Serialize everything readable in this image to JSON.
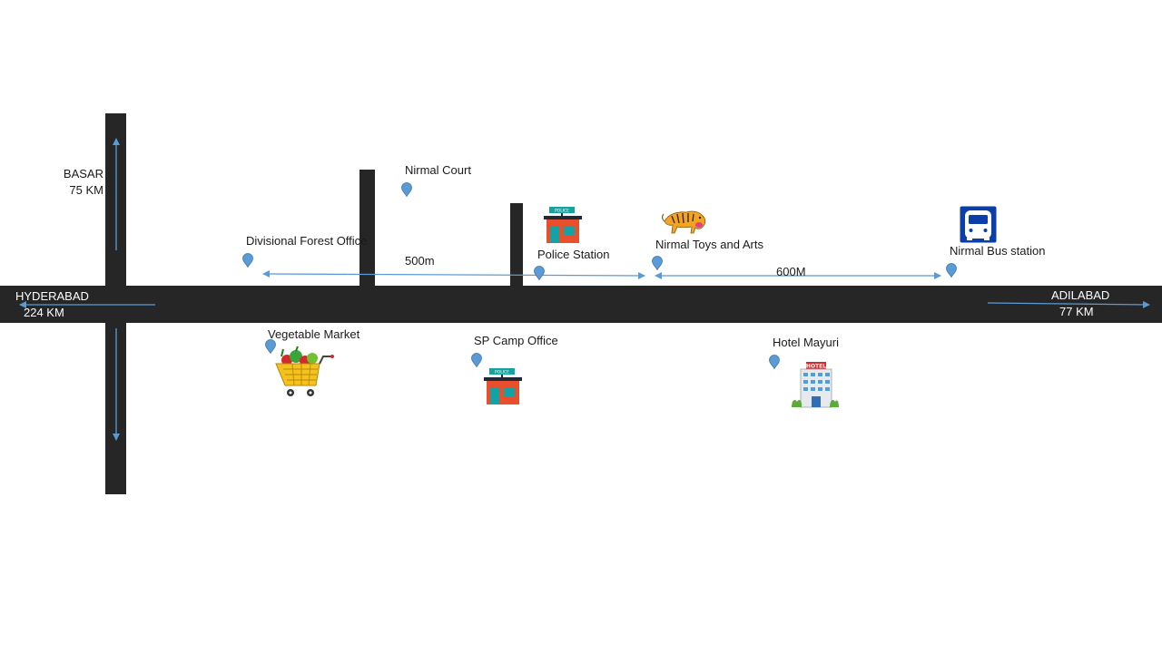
{
  "destinations": {
    "basar": {
      "name": "BASAR",
      "distance": "75 KM"
    },
    "hyderabad": {
      "name": "HYDERABAD",
      "distance": "224 KM"
    },
    "adilabad": {
      "name": "ADILABAD",
      "distance": "77 KM"
    }
  },
  "landmarks": {
    "nirmal_court": "Nirmal Court",
    "divisional_forest_office": "Divisional Forest Office",
    "police_station": "Police Station",
    "nirmal_toys": "Nirmal Toys and Arts",
    "bus_station": "Nirmal Bus station",
    "vegetable_market": "Vegetable Market",
    "sp_camp_office": "SP Camp Office",
    "hotel_mayuri": "Hotel Mayuri"
  },
  "distances": {
    "segment_1": "500m",
    "segment_2": "600M"
  },
  "icon_text": {
    "police_sign": "POLICE",
    "hotel_sign": "HOTEL"
  },
  "colors": {
    "road": "#262626",
    "arrow": "#5b9bd5",
    "pin": "#5b9bd5",
    "bus_sign": "#0b3ea8",
    "building": "#e8502d",
    "building_roof": "#1f2a36"
  }
}
